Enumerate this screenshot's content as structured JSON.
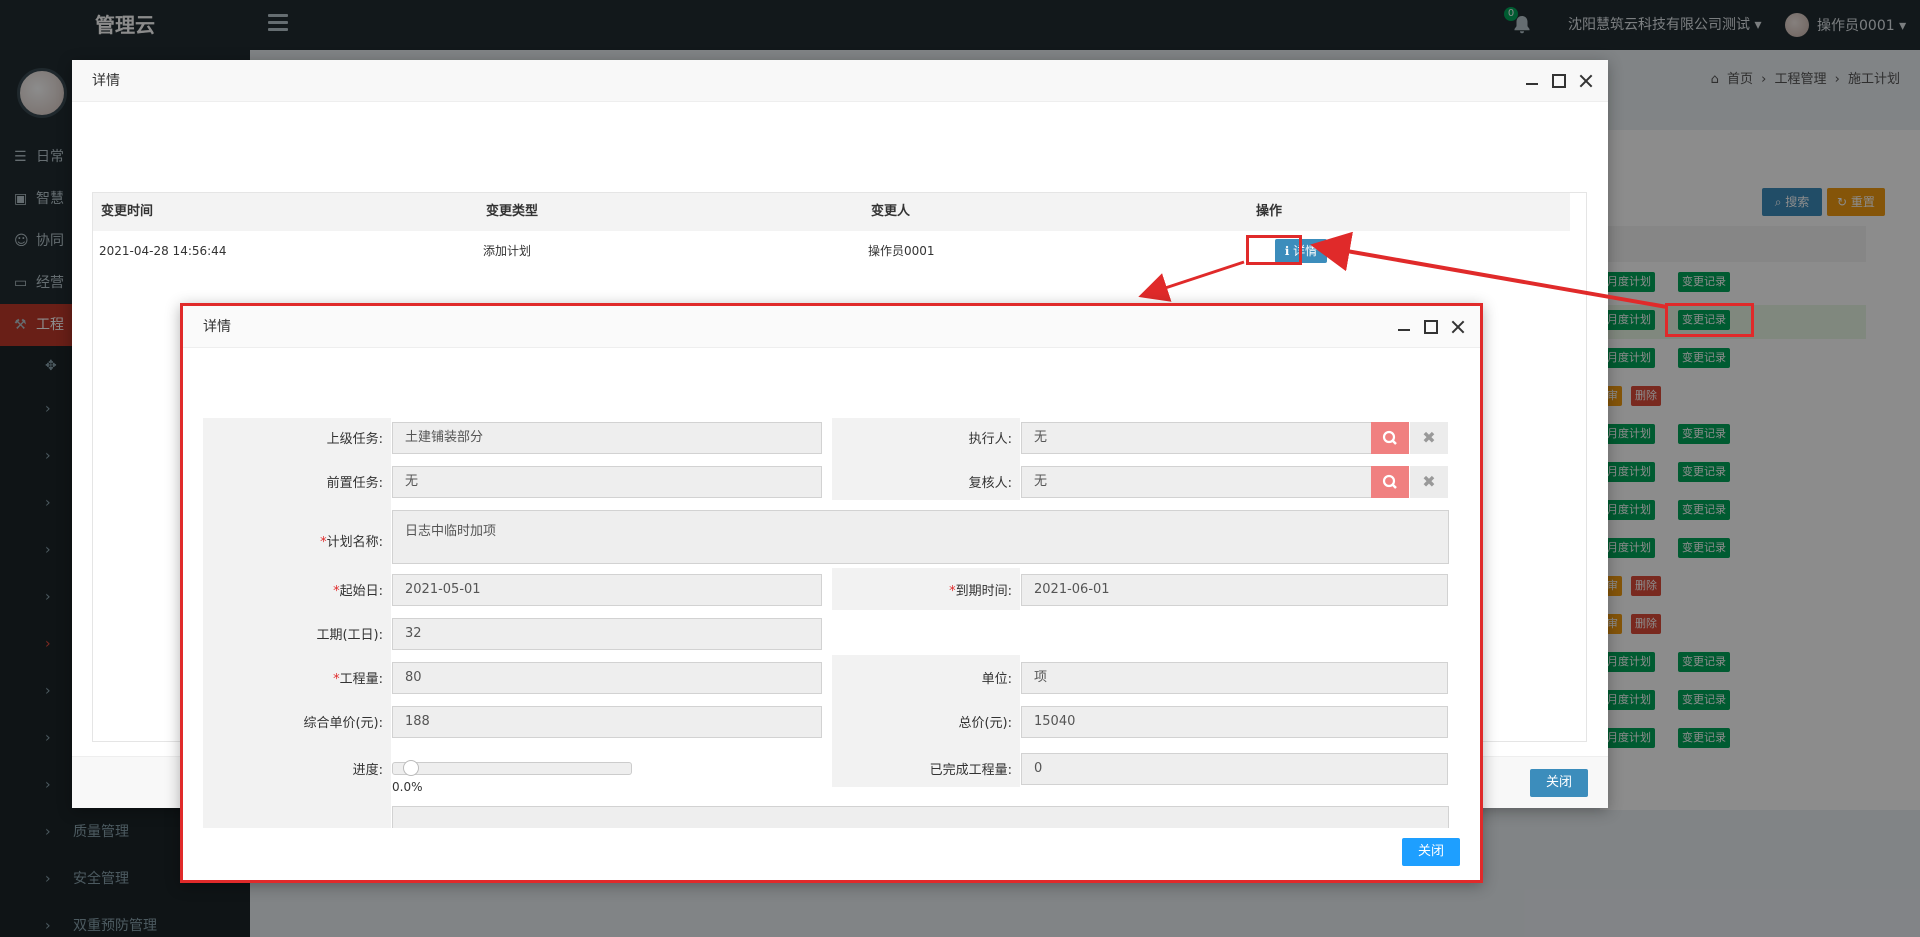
{
  "app": {
    "brand": "管理云"
  },
  "header": {
    "notification_count": "0",
    "company": "沈阳慧筑云科技有限公司测试 ▾",
    "user": "操作员0001 ▾"
  },
  "sidebar": {
    "items": [
      {
        "label": "日常"
      },
      {
        "label": "智慧"
      },
      {
        "label": "协同"
      },
      {
        "label": "经营"
      },
      {
        "label": "工程"
      }
    ],
    "bottom_items": [
      {
        "label": "质量管理"
      },
      {
        "label": "安全管理"
      },
      {
        "label": "双重预防管理"
      }
    ]
  },
  "breadcrumb": {
    "home": "首页",
    "level1": "工程管理",
    "level2": "施工计划"
  },
  "background_table": {
    "search_label": "搜索",
    "reset_label": "重置",
    "monthly_plan_label": "月度计划",
    "change_record_label": "变更记录",
    "audit_label": "审",
    "delete_label": "删除"
  },
  "modal1": {
    "title": "详情",
    "columns": [
      "变更时间",
      "变更类型",
      "变更人",
      "操作"
    ],
    "rows": [
      {
        "time": "2021-04-28 14:56:44",
        "type": "添加计划",
        "person": "操作员0001",
        "action": "详情"
      }
    ],
    "close_label": "关闭"
  },
  "modal2": {
    "title": "详情",
    "fields": {
      "parent_task": {
        "label": "上级任务:",
        "value": "土建铺装部分"
      },
      "executor": {
        "label": "执行人:",
        "value": "无"
      },
      "pre_task": {
        "label": "前置任务:",
        "value": "无"
      },
      "reviewer": {
        "label": "复核人:",
        "value": "无"
      },
      "plan_name": {
        "label": "计划名称:",
        "value": "日志中临时加项"
      },
      "start_date": {
        "label": "起始日:",
        "value": "2021-05-01"
      },
      "due_date": {
        "label": "到期时间:",
        "value": "2021-06-01"
      },
      "duration": {
        "label": "工期(工日):",
        "value": "32"
      },
      "quantity": {
        "label": "工程量:",
        "value": "80"
      },
      "unit": {
        "label": "单位:",
        "value": "项"
      },
      "unit_price": {
        "label": "综合单价(元):",
        "value": "188"
      },
      "total_price": {
        "label": "总价(元):",
        "value": "15040"
      },
      "progress": {
        "label": "进度:",
        "value": "0.0%",
        "fraction": 0.0
      },
      "completed_qty": {
        "label": "已完成工程量:",
        "value": "0"
      }
    },
    "close_label": "关闭"
  },
  "colors": {
    "highlight": "#e02a2a",
    "primary": "#3c8dbc",
    "success": "#00a65a",
    "danger": "#dd4b39",
    "warning": "#f39c12"
  }
}
